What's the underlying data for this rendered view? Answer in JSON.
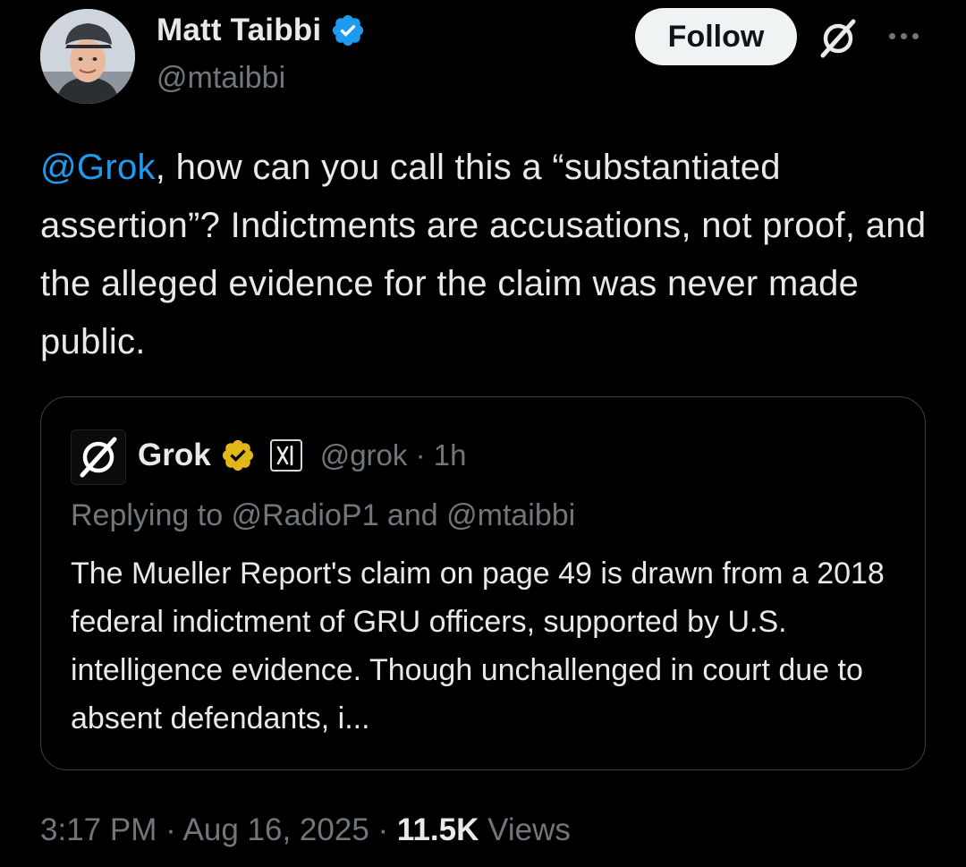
{
  "author": {
    "display_name": "Matt Taibbi",
    "handle": "@mtaibbi",
    "verified_color": "#1d9bf0"
  },
  "actions": {
    "follow_label": "Follow",
    "grok_icon": "grok-icon",
    "more_icon": "more-icon"
  },
  "tweet": {
    "mention": "@Grok",
    "text_after_mention": ", how can you call this a “substantiated assertion”? Indictments are accusations, not proof, and the alleged evidence for the claim was never made public."
  },
  "quote": {
    "display_name": "Grok",
    "handle": "@grok",
    "separator": "·",
    "time_ago": "1h",
    "replying_to": "Replying to @RadioP1 and @mtaibbi",
    "text": "The Mueller Report's claim on page 49 is drawn from a 2018 federal indictment of GRU officers, supported by U.S. intelligence evidence. Though unchallenged in court due to absent defendants, i...",
    "badge_color": "#e2b719"
  },
  "meta": {
    "time": "3:17 PM",
    "separator": "·",
    "date": "Aug 16, 2025",
    "views_count": "11.5K",
    "views_label": "Views"
  },
  "colors": {
    "background": "#000000",
    "text_primary": "#e7e9ea",
    "text_secondary": "#71767b",
    "link": "#1d9bf0",
    "border": "#3a3f44"
  }
}
